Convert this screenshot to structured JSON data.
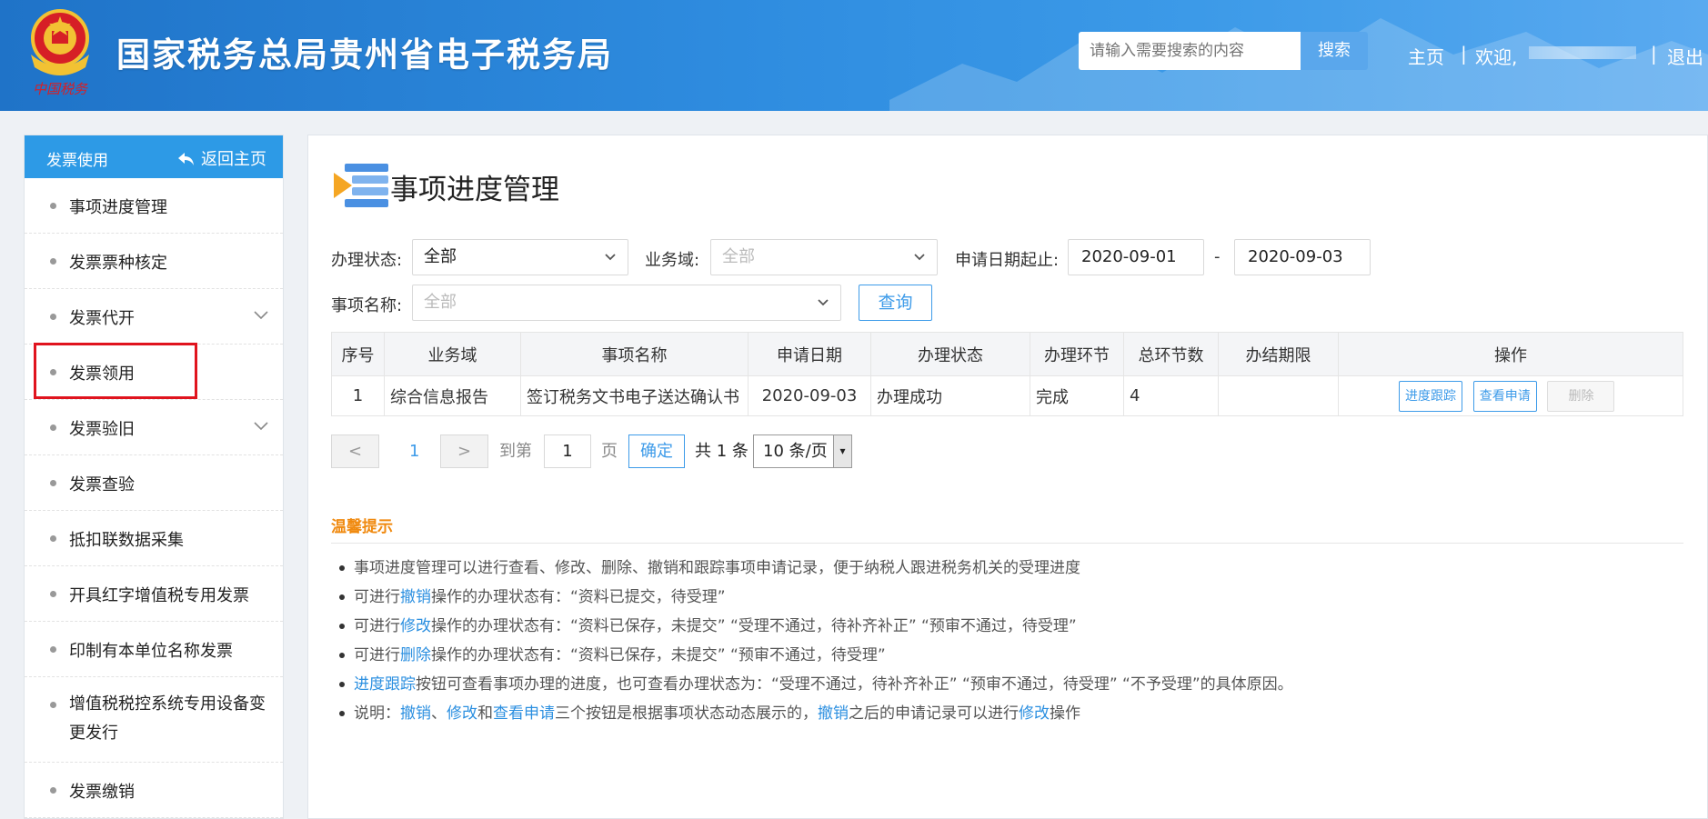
{
  "header": {
    "emblem_text": "中国税务",
    "site_title": "国家税务总局贵州省电子税务局",
    "search_placeholder": "请输入需要搜索的内容",
    "search_button": "搜索",
    "home_link": "主页",
    "sep1": "|",
    "welcome": "欢迎,",
    "sep2": "|",
    "logout": "退出"
  },
  "sidebar": {
    "title": "发票使用",
    "back": "返回主页",
    "items": [
      {
        "label": "事项进度管理",
        "expandable": false
      },
      {
        "label": "发票票种核定",
        "expandable": false
      },
      {
        "label": "发票代开",
        "expandable": true
      },
      {
        "label": "发票领用",
        "expandable": false,
        "highlighted": true
      },
      {
        "label": "发票验旧",
        "expandable": true
      },
      {
        "label": "发票查验",
        "expandable": false
      },
      {
        "label": "抵扣联数据采集",
        "expandable": false
      },
      {
        "label": "开具红字增值税专用发票",
        "expandable": false
      },
      {
        "label": "印制有本单位名称发票",
        "expandable": false
      },
      {
        "label": "增值税税控系统专用设备变更发行",
        "expandable": false
      },
      {
        "label": "发票缴销",
        "expandable": false
      }
    ]
  },
  "main": {
    "title": "事项进度管理",
    "filters": {
      "status_label": "办理状态:",
      "status_value": "全部",
      "domain_label": "业务域:",
      "domain_value": "全部",
      "date_label": "申请日期起止:",
      "date_from": "2020-09-01",
      "date_sep": "-",
      "date_to": "2020-09-03",
      "item_label": "事项名称:",
      "item_value": "全部",
      "query_button": "查询"
    },
    "table": {
      "headers": [
        "序号",
        "业务域",
        "事项名称",
        "申请日期",
        "办理状态",
        "办理环节",
        "总环节数",
        "办结期限",
        "操作"
      ],
      "rows": [
        {
          "no": "1",
          "domain": "综合信息报告",
          "name": "签订税务文书电子送达确认书",
          "date": "2020-09-03",
          "status": "办理成功",
          "stage": "完成",
          "total": "4",
          "deadline": ""
        }
      ],
      "actions": {
        "track": "进度跟踪",
        "view": "查看申请",
        "delete": "删除"
      }
    },
    "pagination": {
      "prev": "<",
      "current": "1",
      "next": ">",
      "goto_label": "到第",
      "goto_value": "1",
      "page_label": "页",
      "confirm": "确定",
      "total": "共 1 条",
      "page_size": "10 条/页"
    },
    "tips": {
      "title": "温馨提示",
      "lines": [
        {
          "parts": [
            {
              "t": "事项进度管理可以进行查看、修改、删除、撤销和跟踪事项申请记录，便于纳税人跟进税务机关的受理进度"
            }
          ]
        },
        {
          "parts": [
            {
              "t": "可进行"
            },
            {
              "t": "撤销",
              "link": true
            },
            {
              "t": "操作的办理状态有：“资料已提交，待受理”"
            }
          ]
        },
        {
          "parts": [
            {
              "t": "可进行"
            },
            {
              "t": "修改",
              "link": true
            },
            {
              "t": "操作的办理状态有：“资料已保存，未提交”  “受理不通过，待补齐补正”  “预审不通过，待受理”"
            }
          ]
        },
        {
          "parts": [
            {
              "t": "可进行"
            },
            {
              "t": "删除",
              "link": true
            },
            {
              "t": "操作的办理状态有：“资料已保存，未提交”  “预审不通过，待受理”"
            }
          ]
        },
        {
          "parts": [
            {
              "t": "进度跟踪",
              "link": true
            },
            {
              "t": "按钮可查看事项办理的进度，也可查看办理状态为：“受理不通过，待补齐补正”  “预审不通过，待受理”  “不予受理”的具体原因。"
            }
          ]
        },
        {
          "parts": [
            {
              "t": "说明："
            },
            {
              "t": "撤销",
              "link": true
            },
            {
              "t": "、"
            },
            {
              "t": "修改",
              "link": true
            },
            {
              "t": "和"
            },
            {
              "t": "查看申请",
              "link": true
            },
            {
              "t": "三个按钮是根据事项状态动态展示的，"
            },
            {
              "t": "撤销",
              "link": true
            },
            {
              "t": "之后的申请记录可以进行"
            },
            {
              "t": "修改",
              "link": true
            },
            {
              "t": "操作"
            }
          ]
        }
      ]
    }
  },
  "colors": {
    "header": "#2f8de0",
    "accent": "#2d9ae6",
    "link": "#2b8fe0",
    "warning": "#f08a10",
    "highlight": "#e0141e"
  }
}
